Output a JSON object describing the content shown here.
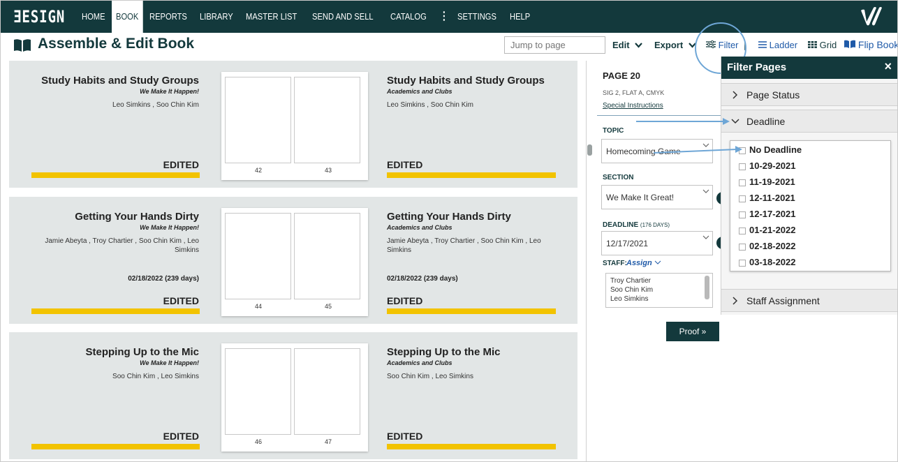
{
  "nav": {
    "logo": "ƎESIGN",
    "items": [
      "HOME",
      "BOOK",
      "REPORTS",
      "LIBRARY",
      "MASTER LIST",
      "SEND AND SELL",
      "CATALOG",
      "⋮",
      "SETTINGS",
      "HELP"
    ],
    "active": "BOOK"
  },
  "header": {
    "title": "Assemble & Edit Book",
    "jump_placeholder": "Jump to page",
    "edit_label": "Edit",
    "export_label": "Export",
    "filter_label": "Filter",
    "separator": "|",
    "ladder_label": "Ladder",
    "grid_label": "Grid",
    "flipbook_label": "Flip Book"
  },
  "spreads": [
    {
      "left": {
        "title": "Study Habits and Study Groups",
        "subtitle": "We Make It Happen!",
        "staff": "Leo Simkins , Soo Chin Kim",
        "date": "",
        "status": "EDITED"
      },
      "right": {
        "title": "Study Habits and Study Groups",
        "subtitle": "Academics and Clubs",
        "staff": "Leo Simkins , Soo Chin Kim",
        "date": "",
        "status": "EDITED"
      },
      "pages": [
        "42",
        "43"
      ]
    },
    {
      "left": {
        "title": "Getting Your Hands Dirty",
        "subtitle": "We Make It Happen!",
        "staff": "Jamie Abeyta , Troy Chartier , Soo Chin Kim , Leo Simkins",
        "date": "02/18/2022 (239 days)",
        "status": "EDITED"
      },
      "right": {
        "title": "Getting Your Hands Dirty",
        "subtitle": "Academics and Clubs",
        "staff": "Jamie Abeyta , Troy Chartier , Soo Chin Kim , Leo Simkins",
        "date": "02/18/2022 (239 days)",
        "status": "EDITED"
      },
      "pages": [
        "44",
        "45"
      ]
    },
    {
      "left": {
        "title": "Stepping Up to the Mic",
        "subtitle": "We Make It Happen!",
        "staff": "Soo Chin Kim , Leo Simkins",
        "date": "",
        "status": "EDITED"
      },
      "right": {
        "title": "Stepping Up to the Mic",
        "subtitle": "Academics and Clubs",
        "staff": "Soo Chin Kim , Leo Simkins",
        "date": "",
        "status": "EDITED"
      },
      "pages": [
        "46",
        "47"
      ]
    }
  ],
  "page_detail": {
    "page": "PAGE 20",
    "sig": "SIG 2, FLAT A, CMYK",
    "special_instructions": "Special Instructions",
    "topic_label": "TOPIC",
    "topic_value": "Homecoming Game",
    "section_label": "SECTION",
    "section_value": "We Make It Great!",
    "deadline_label": "DEADLINE",
    "deadline_days": "(176 DAYS)",
    "deadline_value": "12/17/2021",
    "staff_label": "STAFF:",
    "assign_label": "Assign",
    "staff": [
      "Troy Chartier",
      "Soo Chin Kim",
      "Leo Simkins"
    ],
    "proof_label": "Proof »"
  },
  "filter": {
    "title": "Filter Pages",
    "close": "×",
    "sections": [
      "Page Status",
      "Deadline",
      "Staff Assignment"
    ],
    "deadline_options": [
      "No Deadline",
      "10-29-2021",
      "11-19-2021",
      "12-11-2021",
      "12-17-2021",
      "01-21-2022",
      "02-18-2022",
      "03-18-2022"
    ]
  },
  "colors": {
    "nav_bg": "#13393c",
    "panel_bg": "#e2e6e6",
    "status_bar": "#f2c300",
    "link": "#1f5aa8",
    "annotation": "#6ea6d6"
  }
}
